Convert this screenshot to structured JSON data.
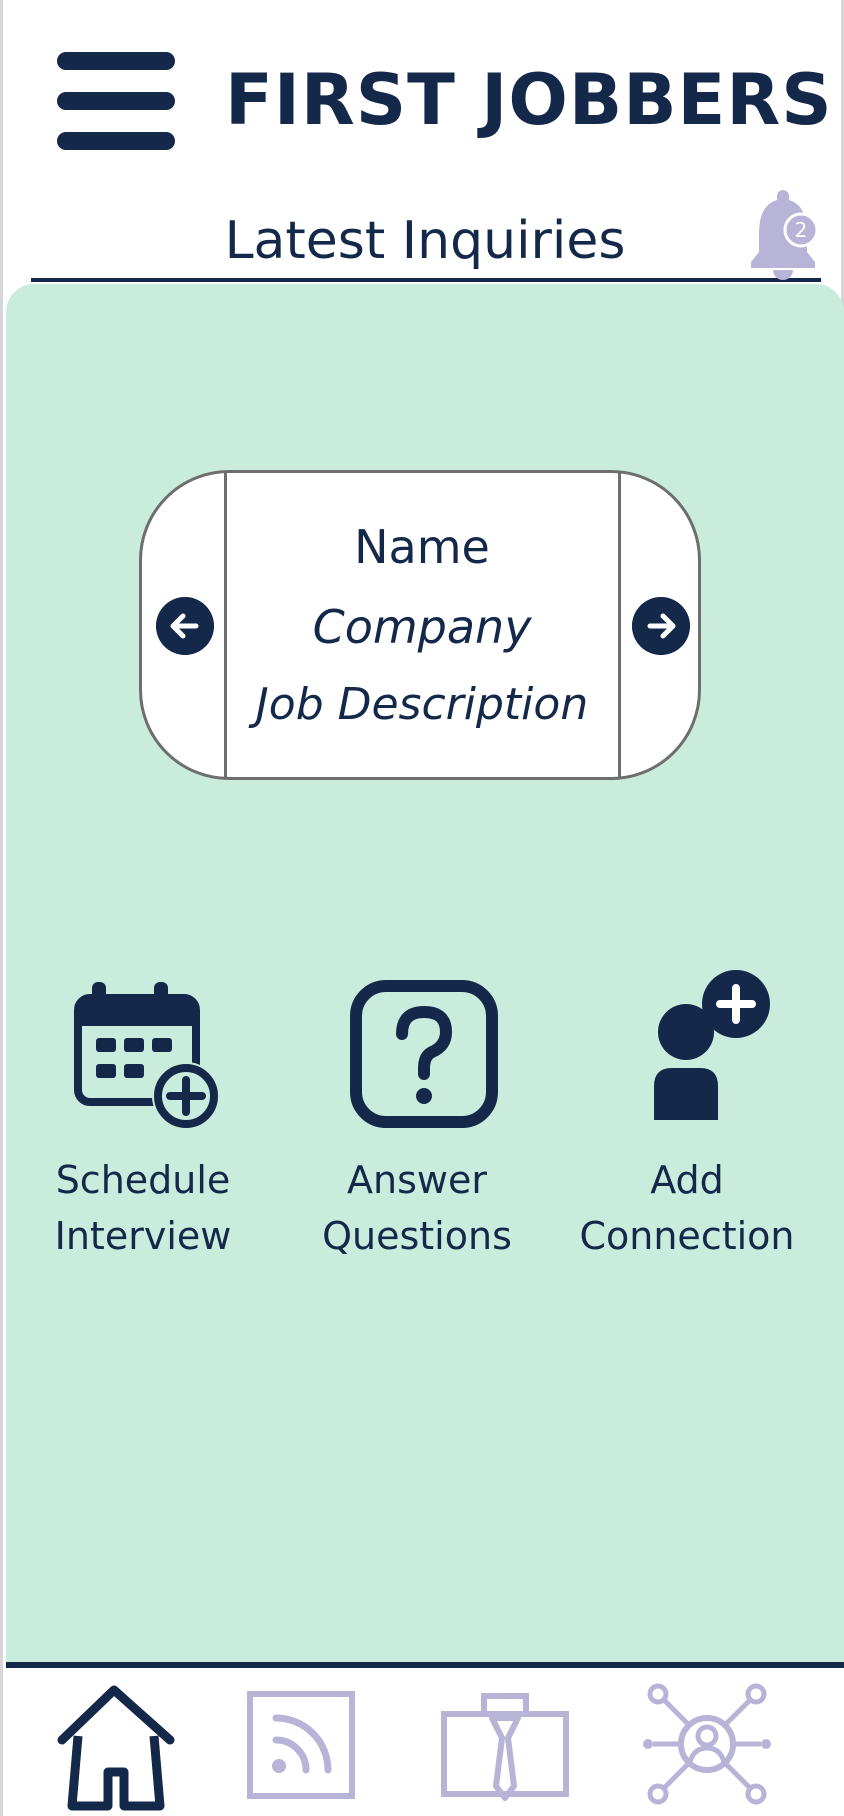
{
  "header": {
    "app_title": "FIRST JOBBERS",
    "menu_icon": "hamburger-menu-icon"
  },
  "inquiries": {
    "title": "Latest Inquiries",
    "notification_count": "2",
    "card": {
      "name": "Name",
      "company": "Company",
      "job_description": "Job Description"
    }
  },
  "actions": [
    {
      "line1": "Schedule",
      "line2": "Interview",
      "icon": "calendar-add-icon"
    },
    {
      "line1": "Answer",
      "line2": "Questions",
      "icon": "question-mark-icon"
    },
    {
      "line1": "Add",
      "line2": "Connection",
      "icon": "add-person-icon"
    }
  ],
  "bottom_nav": {
    "items": [
      {
        "icon": "home-icon",
        "active": true
      },
      {
        "icon": "feed-icon",
        "active": false
      },
      {
        "icon": "briefcase-icon",
        "active": false
      },
      {
        "icon": "network-icon",
        "active": false
      }
    ]
  },
  "colors": {
    "primary": "#14284a",
    "panel_background": "#c9ecdc",
    "inactive_icon": "#b7b4d8",
    "card_border": "#6e6e6e"
  }
}
